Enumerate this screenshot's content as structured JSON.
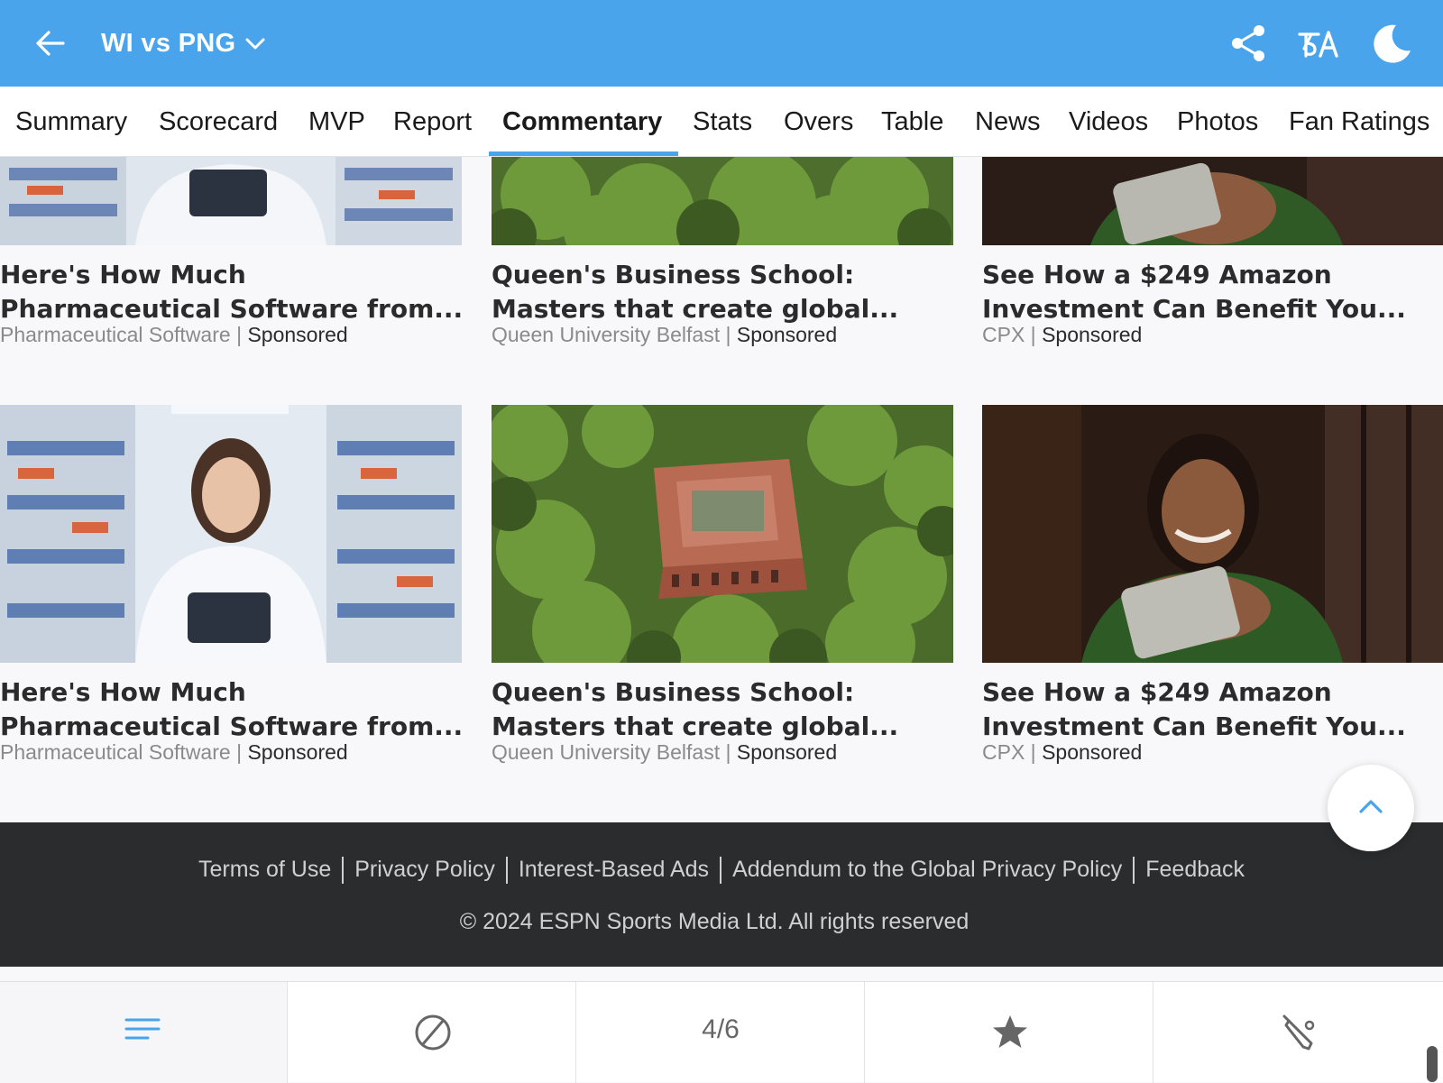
{
  "header": {
    "title": "WI vs PNG",
    "bg_color": "#4aa4ec",
    "icons": [
      "back-arrow-icon",
      "chevron-down-icon",
      "share-icon",
      "language-icon",
      "dark-mode-moon-icon"
    ]
  },
  "tabs": [
    {
      "label": "Summary"
    },
    {
      "label": "Scorecard"
    },
    {
      "label": "MVP"
    },
    {
      "label": "Report"
    },
    {
      "label": "Commentary",
      "active": true
    },
    {
      "label": "Stats"
    },
    {
      "label": "Overs"
    },
    {
      "label": "Table"
    },
    {
      "label": "News"
    },
    {
      "label": "Videos"
    },
    {
      "label": "Photos"
    },
    {
      "label": "Fan Ratings"
    }
  ],
  "cards": [
    {
      "line1": "Here's How Much",
      "line2": "Pharmaceutical Software from...",
      "source": "Pharmaceutical Software",
      "sponsored": "Sponsored"
    },
    {
      "line1": "Queen's Business School:",
      "line2": "Masters that create global...",
      "source": "Queen University Belfast",
      "sponsored": "Sponsored"
    },
    {
      "line1": "See How a $249 Amazon",
      "line2": "Investment Can Benefit You...",
      "source": "CPX",
      "sponsored": "Sponsored"
    },
    {
      "line1": "Here's How Much",
      "line2": "Pharmaceutical Software from...",
      "source": "Pharmaceutical Software",
      "sponsored": "Sponsored"
    },
    {
      "line1": "Queen's Business School:",
      "line2": "Masters that create global...",
      "source": "Queen University Belfast",
      "sponsored": "Sponsored"
    },
    {
      "line1": "See How a $249 Amazon",
      "line2": "Investment Can Benefit You...",
      "source": "CPX",
      "sponsored": "Sponsored"
    }
  ],
  "footer": {
    "links": [
      "Terms of Use",
      "Privacy Policy",
      "Interest-Based Ads",
      "Addendum to the Global Privacy Policy",
      "Feedback"
    ],
    "copyright": "© 2024 ESPN Sports Media Ltd. All rights reserved",
    "bg_color": "#2b2c2e"
  },
  "bottom_nav": {
    "items": [
      {
        "icon": "menu-lines-icon"
      },
      {
        "icon": "ball-icon"
      },
      {
        "label": "4/6"
      },
      {
        "icon": "star-icon"
      },
      {
        "icon": "cricket-bat-icon"
      }
    ]
  }
}
